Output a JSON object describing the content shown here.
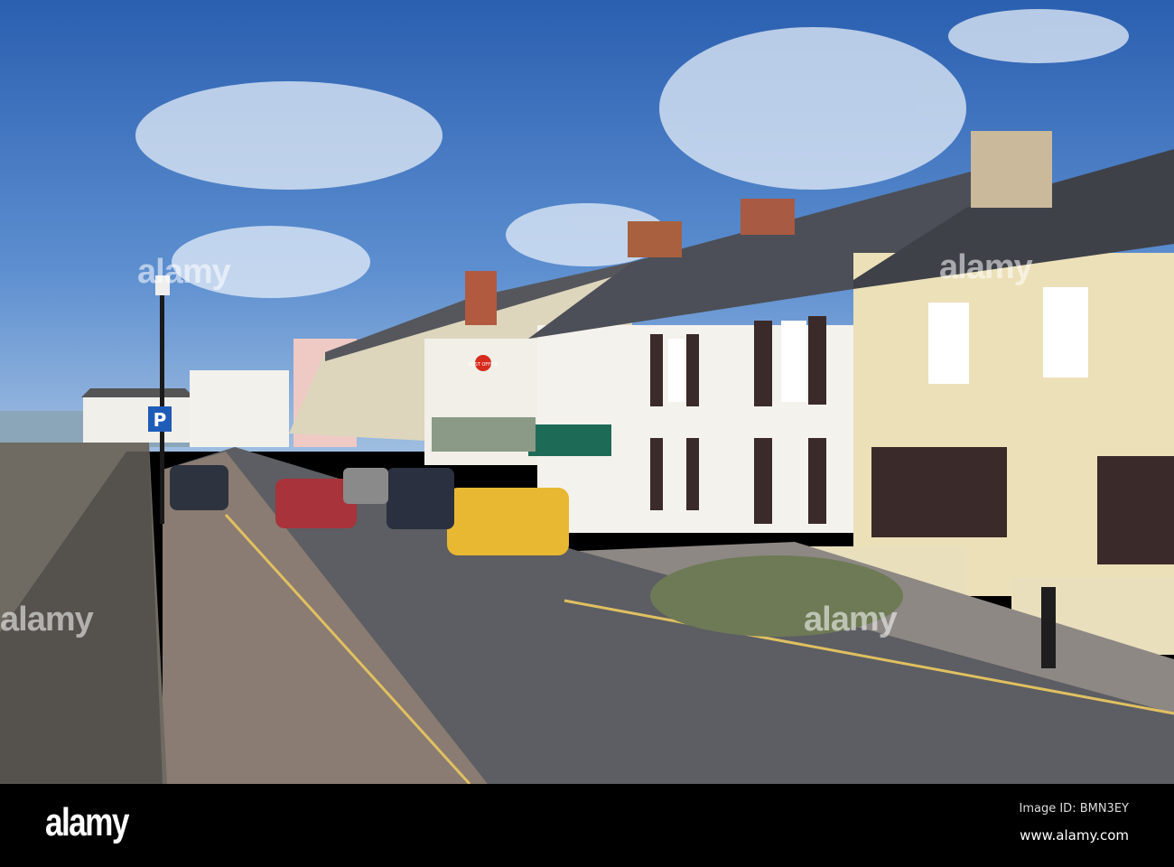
{
  "photo": {
    "subject": "seaside street",
    "shop_sign": "POST OFFICE",
    "parking_sign": "P"
  },
  "watermark": {
    "text": "alamy"
  },
  "footer": {
    "logo": "alamy",
    "image_id": "Image ID: BMN3EY",
    "website": "www.alamy.com"
  }
}
